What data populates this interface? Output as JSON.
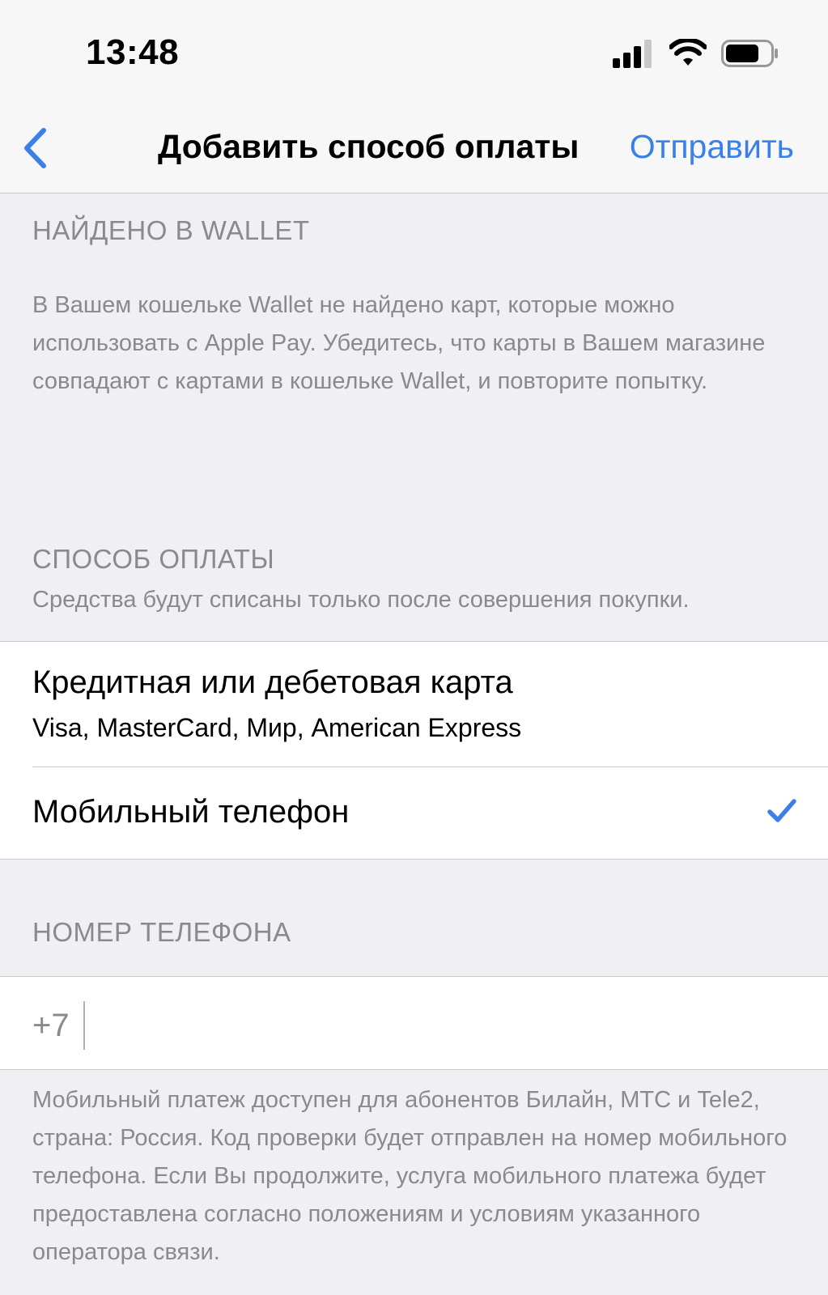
{
  "status_bar": {
    "time": "13:48",
    "icons": [
      "signal-icon",
      "wifi-icon",
      "battery-icon"
    ]
  },
  "nav": {
    "back_icon": "chevron-left-icon",
    "title": "Добавить способ оплаты",
    "action_label": "Отправить"
  },
  "wallet_section": {
    "header": "НАЙДЕНО В WALLET",
    "text": "В Вашем кошельке Wallet не найдено карт, которые можно использовать с Apple Pay. Убедитесь, что карты в Вашем магазине совпадают с картами в кошельке Wallet, и повторите попытку."
  },
  "payment_section": {
    "header": "СПОСОБ ОПЛАТЫ",
    "subheader": "Средства будут списаны только после совершения покупки.",
    "options": [
      {
        "title": "Кредитная или дебетовая карта",
        "subtitle": "Visa, MasterCard, Мир, American Express",
        "selected": false
      },
      {
        "title": "Мобильный телефон",
        "subtitle": "",
        "selected": true
      }
    ]
  },
  "phone_section": {
    "header": "НОМЕР ТЕЛЕФОНА",
    "prefix": "+7",
    "value": "",
    "footer": "Мобильный платеж доступен для абонентов Билайн, МТС и Tele2, страна: Россия. Код проверки будет отправлен на номер мобильного телефона. Если Вы продолжите, услуга мобильного платежа будет предоставлена согласно положениям и условиям указанного оператора связи."
  },
  "colors": {
    "accent": "#3a80e8",
    "background": "#f0f0f4",
    "secondary_text": "#8a8a8e"
  }
}
